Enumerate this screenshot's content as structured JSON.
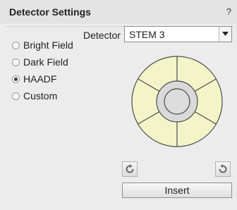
{
  "panel": {
    "title": "Detector Settings",
    "help_label": "?"
  },
  "detector": {
    "label": "Detector",
    "selected": "STEM 3"
  },
  "modes": [
    {
      "label": "Bright Field",
      "checked": false
    },
    {
      "label": "Dark Field",
      "checked": false
    },
    {
      "label": "HAADF",
      "checked": true
    },
    {
      "label": "Custom",
      "checked": false
    }
  ],
  "segment_colors": {
    "segment_fill": "#f3f5c9",
    "inner_ring_fill": "#d9d9d9",
    "outline": "#4a4a4a"
  },
  "icons": {
    "rotate_left": "rotate-counterclockwise-icon",
    "rotate_right": "rotate-clockwise-icon",
    "dropdown": "chevron-down-icon"
  },
  "actions": {
    "insert_label": "Insert"
  }
}
